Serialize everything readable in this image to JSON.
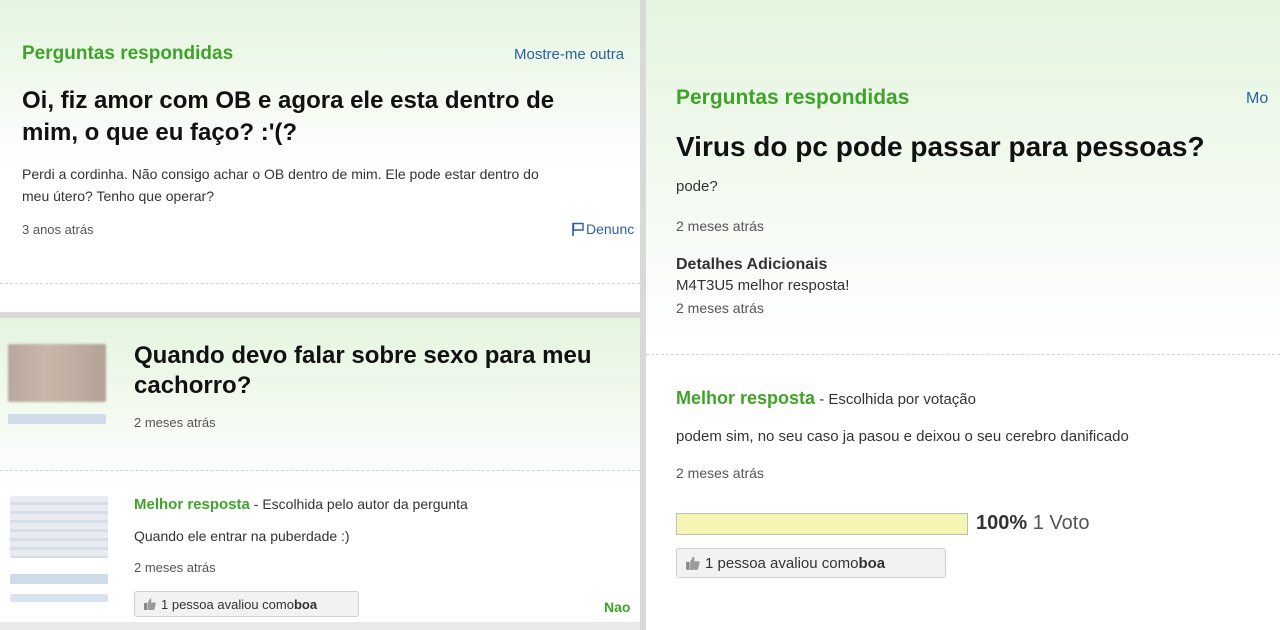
{
  "q1": {
    "section_title": "Perguntas respondidas",
    "show_other": "Mostre-me outra",
    "title_line1": "Oi, fiz amor com OB e agora ele esta dentro de",
    "title_line2": "mim, o que eu faço? :'(?",
    "body_line1": "Perdi a cordinha. Não consigo achar o OB dentro de mim. Ele pode estar dentro do",
    "body_line2": "meu útero? Tenho que operar?",
    "time": "3 anos atrás",
    "report": "Denunc"
  },
  "q2": {
    "title_line1": "Quando devo falar sobre sexo para meu",
    "title_line2": "cachorro?",
    "time": "2 meses atrás",
    "best_label": "Melhor resposta",
    "best_chosen": " - Escolhida pelo autor da pergunta",
    "answer": "Quando ele entrar na puberdade :)",
    "answer_time": "2 meses atrás",
    "rating_prefix": "1 pessoa avaliou como ",
    "rating_bold": "boa",
    "footer_partial": "Nao"
  },
  "q3": {
    "section_title": "Perguntas respondidas",
    "show_other_partial": "Mo",
    "title": "Virus do pc pode passar para pessoas?",
    "body": "pode?",
    "time": "2 meses atrás",
    "details_label": "Detalhes Adicionais",
    "details_text": "M4T3U5 melhor resposta!",
    "details_time": "2 meses atrás",
    "best_label": "Melhor resposta",
    "best_chosen": " - Escolhida por votação",
    "answer": "podem sim, no seu caso ja pasou e deixou o seu cerebro danificado",
    "answer_time": "2 meses atrás",
    "vote_percent": "100%",
    "vote_count": "1 Voto",
    "vote_fraction": 1.0,
    "rating_prefix": "1 pessoa avaliou como ",
    "rating_bold": "boa"
  },
  "colors": {
    "accent_green": "#3fa32a",
    "link_blue": "#2a5fa8",
    "vote_bar": "#f6f5b3"
  }
}
